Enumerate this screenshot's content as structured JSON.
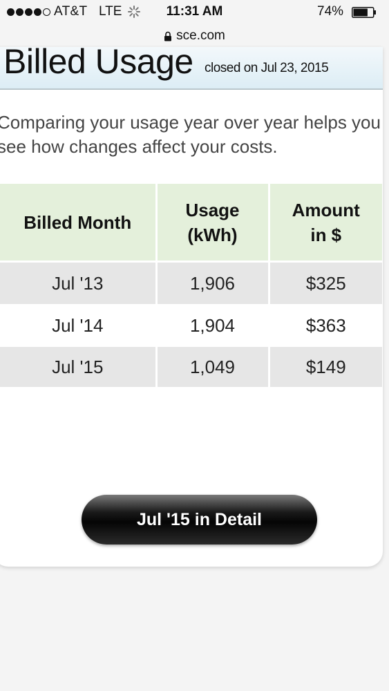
{
  "status_bar": {
    "carrier": "AT&T",
    "network": "LTE",
    "time": "11:31 AM",
    "battery_percent": "74%",
    "battery_level": 0.74,
    "signal_bars_filled": 4,
    "signal_bars_total": 5
  },
  "browser": {
    "url": "sce.com",
    "lock_icon": "lock-icon"
  },
  "header": {
    "title": "Billed Usage",
    "subtitle": "closed on Jul 23, 2015"
  },
  "description": {
    "line1": "Comparing your usage year over year helps you",
    "line2": "see how changes affect your costs."
  },
  "table": {
    "headers": {
      "billed_month": "Billed Month",
      "usage_line1": "Usage",
      "usage_line2": "(kWh)",
      "amount_line1": "Amount",
      "amount_line2": "in $"
    },
    "rows": [
      {
        "month": "Jul '13",
        "usage": "1,906",
        "amount": "$325"
      },
      {
        "month": "Jul '14",
        "usage": "1,904",
        "amount": "$363"
      },
      {
        "month": "Jul '15",
        "usage": "1,049",
        "amount": "$149"
      }
    ]
  },
  "detail_button": {
    "label": "Jul '15 in Detail"
  },
  "colors": {
    "header_bg": "#e4f0db",
    "row_shaded": "#e6e6e6",
    "title_band": "#dcedf5",
    "button": "#050505"
  }
}
